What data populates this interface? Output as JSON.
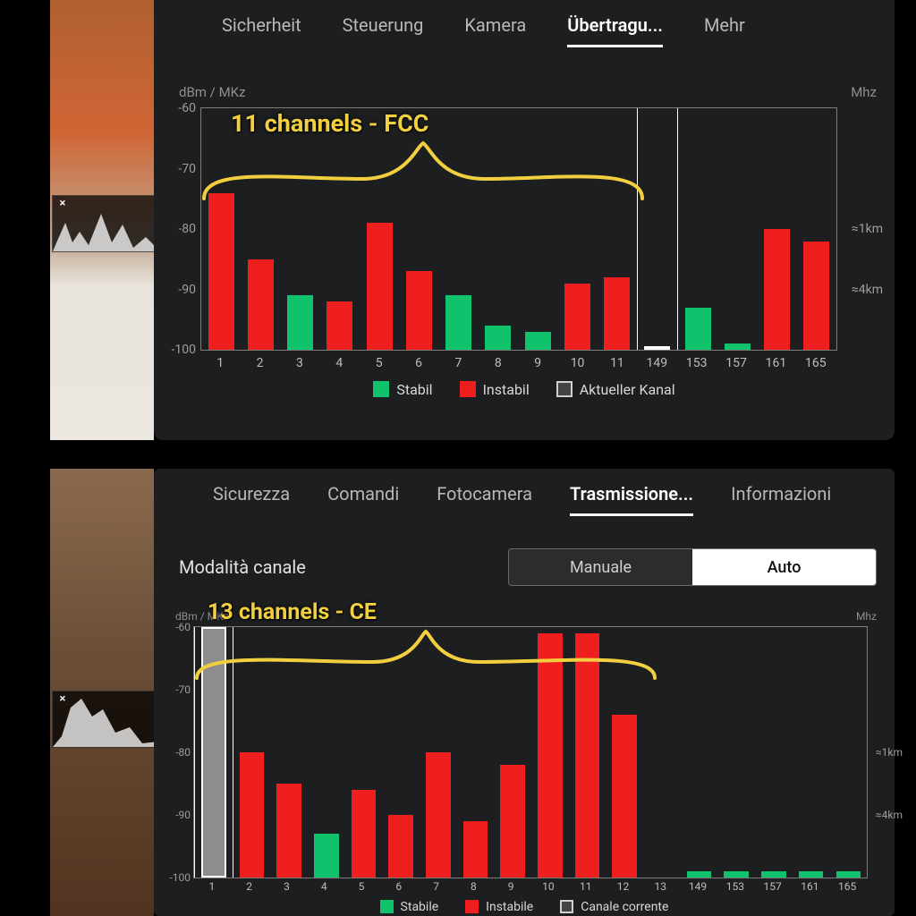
{
  "top": {
    "tabs": [
      "Sicherheit",
      "Steuerung",
      "Kamera",
      "Übertragu...",
      "Mehr"
    ],
    "active_tab": 3,
    "y_title": "dBm / MKz",
    "right_unit": "Mhz",
    "y_ticks": [
      "-60",
      "-70",
      "-80",
      "-90",
      "-100"
    ],
    "r_ticks": [
      {
        "pos": -80,
        "label": "≈1km"
      },
      {
        "pos": -90,
        "label": "≈4km"
      }
    ],
    "legend": {
      "stable": "Stabil",
      "unstable": "Instabil",
      "current": "Aktueller Kanal"
    },
    "annotation": "11 channels - FCC"
  },
  "bottom": {
    "tabs": [
      "Sicurezza",
      "Comandi",
      "Fotocamera",
      "Trasmissione...",
      "Informazioni"
    ],
    "active_tab": 3,
    "mode_label": "Modalità canale",
    "mode_options": [
      "Manuale",
      "Auto"
    ],
    "mode_active": 1,
    "y_title": "dBm / MKz",
    "right_unit": "Mhz",
    "y_ticks": [
      "-60",
      "-70",
      "-80",
      "-90",
      "-100"
    ],
    "r_ticks": [
      {
        "pos": -80,
        "label": "≈1km"
      },
      {
        "pos": -90,
        "label": "≈4km"
      }
    ],
    "legend": {
      "stable": "Stabile",
      "unstable": "Instabile",
      "current": "Canale corrente"
    },
    "annotation": "13 channels - CE"
  },
  "chart_data": [
    {
      "type": "bar",
      "title": "11 channels - FCC",
      "ylabel": "dBm / MKz",
      "ylim": [
        -100,
        -60
      ],
      "categories": [
        "1",
        "2",
        "3",
        "4",
        "5",
        "6",
        "7",
        "8",
        "9",
        "10",
        "11",
        "149",
        "153",
        "157",
        "161",
        "165"
      ],
      "current_channel": "149",
      "series": [
        {
          "name": "value_dbm",
          "values": [
            -74,
            -85,
            -91,
            -92,
            -79,
            -87,
            -91,
            -96,
            -97,
            -89,
            -88,
            -100,
            -93,
            -99,
            -80,
            -82
          ]
        },
        {
          "name": "state",
          "values": [
            "unstable",
            "unstable",
            "stable",
            "unstable",
            "unstable",
            "unstable",
            "stable",
            "stable",
            "stable",
            "unstable",
            "unstable",
            "current",
            "stable",
            "stable",
            "unstable",
            "unstable"
          ]
        }
      ]
    },
    {
      "type": "bar",
      "title": "13 channels - CE",
      "ylabel": "dBm / MKz",
      "ylim": [
        -100,
        -60
      ],
      "categories": [
        "1",
        "2",
        "3",
        "4",
        "5",
        "6",
        "7",
        "8",
        "9",
        "10",
        "11",
        "12",
        "13",
        "149",
        "153",
        "157",
        "161",
        "165"
      ],
      "current_channel": "1",
      "series": [
        {
          "name": "value_dbm",
          "values": [
            -60,
            -80,
            -85,
            -93,
            -86,
            -90,
            -80,
            -91,
            -82,
            -61,
            -61,
            -74,
            -100,
            -99,
            -99,
            -99,
            -99,
            -99
          ]
        },
        {
          "name": "state",
          "values": [
            "current",
            "unstable",
            "unstable",
            "stable",
            "unstable",
            "unstable",
            "unstable",
            "unstable",
            "unstable",
            "unstable",
            "unstable",
            "unstable",
            "stable",
            "stable",
            "stable",
            "stable",
            "stable",
            "stable"
          ]
        }
      ]
    }
  ]
}
